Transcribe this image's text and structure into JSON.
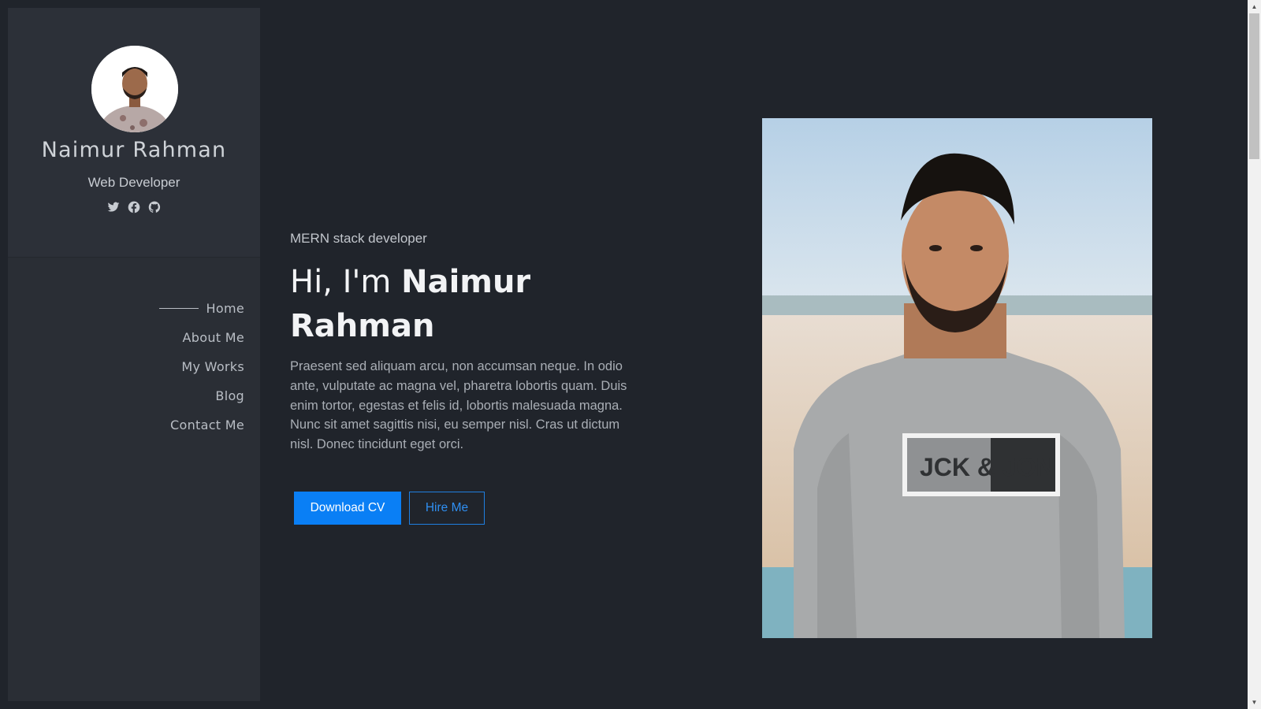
{
  "sidebar": {
    "name": "Naimur Rahman",
    "role": "Web Developer",
    "social": [
      {
        "icon": "twitter-icon"
      },
      {
        "icon": "facebook-icon"
      },
      {
        "icon": "github-icon"
      }
    ],
    "nav": [
      {
        "label": "Home",
        "active": true
      },
      {
        "label": "About Me"
      },
      {
        "label": "My Works"
      },
      {
        "label": "Blog"
      },
      {
        "label": "Contact Me"
      }
    ]
  },
  "hero": {
    "eyebrow": "MERN stack developer",
    "greeting": "Hi, I'm ",
    "name": "Naimur Rahman",
    "bio": "Praesent sed aliquam arcu, non accumsan neque. In odio ante, vulputate ac magna vel, pharetra lobortis quam. Duis enim tortor, egestas et felis id, lobortis malesuada magna. Nunc sit amet sagittis nisi, eu semper nisl. Cras ut dictum nisl. Donec tincidunt eget orci.",
    "primary_button": "Download CV",
    "secondary_button": "Hire Me",
    "photo_shirt_text": "JCK & JON"
  },
  "colors": {
    "background": "#20242b",
    "sidebar": "#2a2e35",
    "accent": "#0a7ff5"
  }
}
